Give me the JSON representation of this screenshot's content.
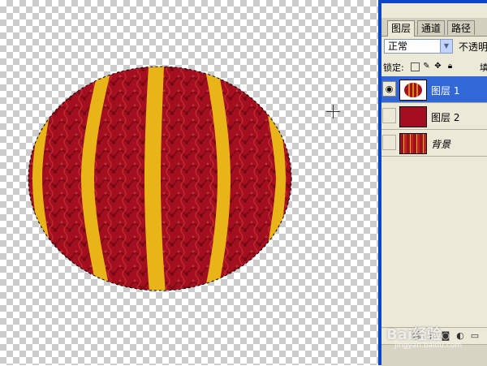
{
  "canvas": {
    "transparency_pattern": "checkerboard",
    "object": "red lantern with yellow vertical stripes",
    "fill_color": "#a30f1e",
    "stripe_color": "#e8b417"
  },
  "panel": {
    "tabs": [
      {
        "label": "图层",
        "active": true
      },
      {
        "label": "通道",
        "active": false
      },
      {
        "label": "路径",
        "active": false
      }
    ],
    "blend_mode": "正常",
    "opacity_label": "不透明",
    "lock_label": "锁定:",
    "fill_label": "填",
    "layers": [
      {
        "name": "图层 1",
        "visible": true,
        "selected": true,
        "thumb": "lantern"
      },
      {
        "name": "图层 2",
        "visible": false,
        "selected": false,
        "thumb": "red"
      },
      {
        "name": "背景",
        "visible": false,
        "selected": false,
        "thumb": "stripes",
        "italic": true
      }
    ],
    "colors": {
      "selection": "#3168d5",
      "panel_bg": "#ece9d8",
      "frame": "#0a46c6"
    }
  },
  "watermark": {
    "text": "Bai经验",
    "url": "jingyan.baidu.com"
  }
}
